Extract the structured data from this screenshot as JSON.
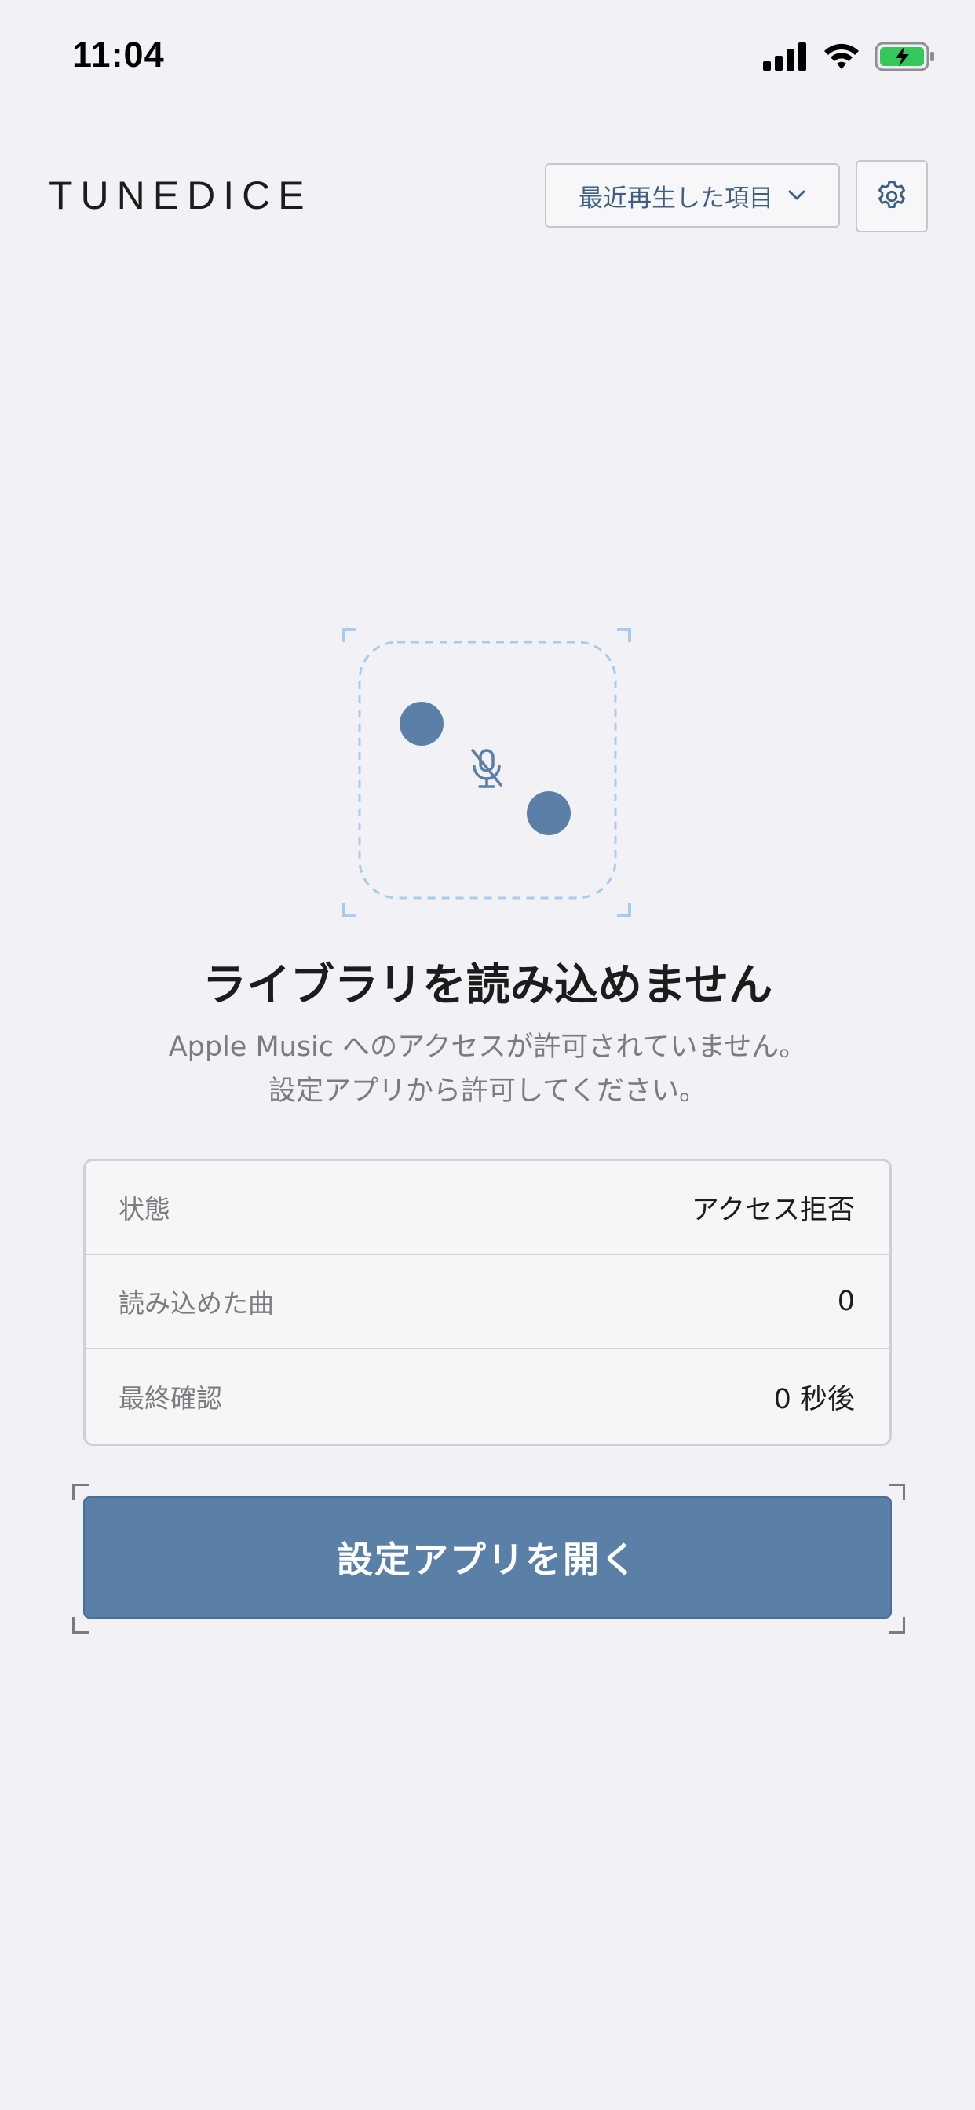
{
  "status_bar": {
    "time": "11:04",
    "icons": [
      "cellular-signal-icon",
      "wifi-icon",
      "battery-charging-icon"
    ]
  },
  "header": {
    "brand": "TUNEDICE",
    "filter_dropdown": {
      "selected": "最近再生した項目",
      "icon": "chevron-down-icon"
    },
    "settings_icon": "gear-icon"
  },
  "illustration": {
    "icon": "dice-with-muted-microphone",
    "pip_color": "#5a80a8",
    "outline_color": "#a9cbf0"
  },
  "error": {
    "title": "ライブラリを読み込めません",
    "message_lines": [
      "Apple Music へのアクセスが許可されていません。",
      "設定アプリから許可してください。"
    ]
  },
  "info_table": [
    {
      "label": "状態",
      "value": "アクセス拒否"
    },
    {
      "label": "読み込めた曲",
      "value": "0"
    },
    {
      "label": "最終確認",
      "value": "0 秒後"
    }
  ],
  "primary_action": {
    "label": "設定アプリを開く"
  },
  "colors": {
    "background": "#f2f2f6",
    "accent": "#5a80a8",
    "accent_text": "#3f5f83",
    "muted_text": "#7b7b80"
  }
}
